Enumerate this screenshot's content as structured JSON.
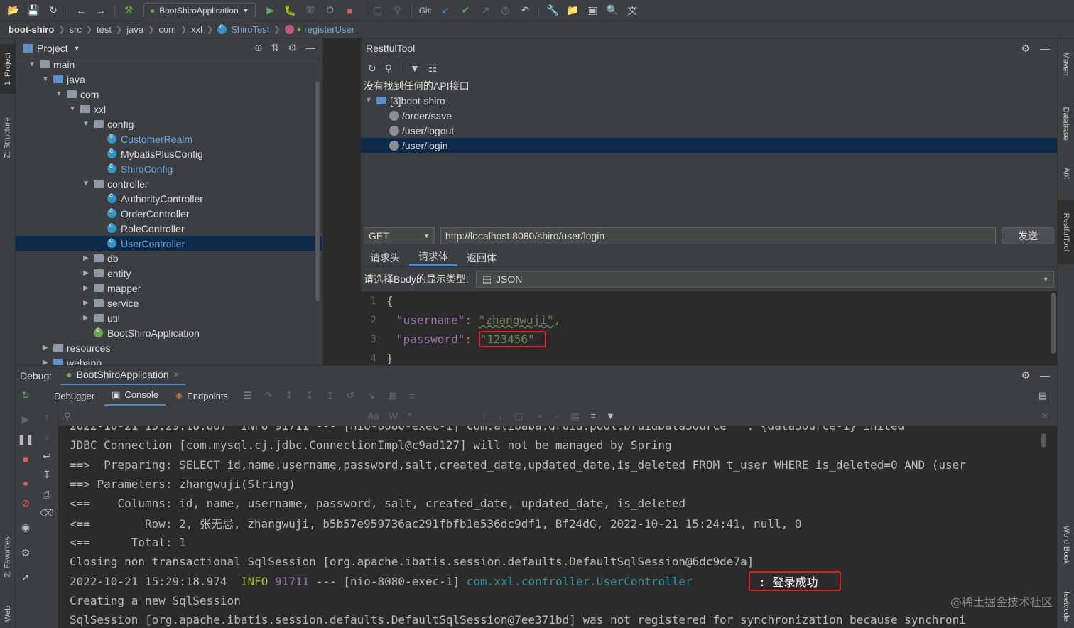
{
  "toolbar": {
    "run_config": "BootShiroApplication",
    "git_label": "Git:"
  },
  "breadcrumb": {
    "items": [
      "boot-shiro",
      "src",
      "test",
      "java",
      "com",
      "xxl",
      "ShiroTest",
      "registerUser"
    ]
  },
  "left_strip": {
    "project": "1: Project",
    "structure": "Z: Structure",
    "favorites": "2: Favorites",
    "web": "Web"
  },
  "right_strip": {
    "maven": "Maven",
    "database": "Database",
    "ant": "Ant",
    "restfultool": "RestfulTool",
    "wordbook": "Word Book",
    "leetcode": "leetcode"
  },
  "project_panel": {
    "title": "Project",
    "tree": [
      {
        "label": "main",
        "depth": 2,
        "type": "folder",
        "expanded": true
      },
      {
        "label": "java",
        "depth": 3,
        "type": "folder-blue",
        "expanded": true
      },
      {
        "label": "com",
        "depth": 4,
        "type": "folder",
        "expanded": true
      },
      {
        "label": "xxl",
        "depth": 5,
        "type": "folder",
        "expanded": true
      },
      {
        "label": "config",
        "depth": 6,
        "type": "folder",
        "expanded": true
      },
      {
        "label": "CustomerRealm",
        "depth": 7,
        "type": "class",
        "highlight": true
      },
      {
        "label": "MybatisPlusConfig",
        "depth": 7,
        "type": "class"
      },
      {
        "label": "ShiroConfig",
        "depth": 7,
        "type": "class",
        "highlight": true
      },
      {
        "label": "controller",
        "depth": 6,
        "type": "folder",
        "expanded": true
      },
      {
        "label": "AuthorityController",
        "depth": 7,
        "type": "class"
      },
      {
        "label": "OrderController",
        "depth": 7,
        "type": "class"
      },
      {
        "label": "RoleController",
        "depth": 7,
        "type": "class"
      },
      {
        "label": "UserController",
        "depth": 7,
        "type": "class",
        "highlight": true,
        "selected": true
      },
      {
        "label": "db",
        "depth": 6,
        "type": "folder",
        "expanded": false
      },
      {
        "label": "entity",
        "depth": 6,
        "type": "folder",
        "expanded": false
      },
      {
        "label": "mapper",
        "depth": 6,
        "type": "folder",
        "expanded": false
      },
      {
        "label": "service",
        "depth": 6,
        "type": "folder",
        "expanded": false
      },
      {
        "label": "util",
        "depth": 6,
        "type": "folder",
        "expanded": false
      },
      {
        "label": "BootShiroApplication",
        "depth": 6,
        "type": "boot"
      },
      {
        "label": "resources",
        "depth": 3,
        "type": "folder",
        "expanded": false
      },
      {
        "label": "webapp",
        "depth": 3,
        "type": "folder-blue",
        "expanded": false
      }
    ]
  },
  "restful": {
    "title": "RestfulTool",
    "no_api_msg": "没有找到任何的API接口",
    "module": "[3]boot-shiro",
    "apis": [
      {
        "path": "/order/save",
        "selected": false
      },
      {
        "path": "/user/logout",
        "selected": false
      },
      {
        "path": "/user/login",
        "selected": true
      }
    ],
    "method": "GET",
    "url": "http://localhost:8080/shiro/user/login",
    "send_label": "发送",
    "tabs": [
      "请求头",
      "请求体",
      "返回体"
    ],
    "active_tab": "请求体",
    "body_type_label": "请选择Body的显示类型:",
    "body_type_value": "JSON",
    "body_lines": [
      {
        "num": "1",
        "text": "{"
      },
      {
        "num": "2",
        "key": "\"username\"",
        "value": "\"zhangwuji\""
      },
      {
        "num": "3",
        "key": "\"password\"",
        "value": "\"123456\""
      },
      {
        "num": "4",
        "text": "}"
      }
    ]
  },
  "debug": {
    "label": "Debug:",
    "session": "BootShiroApplication",
    "subtabs": [
      "Debugger",
      "Console",
      "Endpoints"
    ],
    "active_subtab": "Console"
  },
  "console": {
    "lines": [
      "2022-10-21 15:29:18.887  INFO 91711 --- [nio-8080-exec-1] com.alibaba.druid.pool.DruidDataSource   : {dataSource-1} inited",
      "JDBC Connection [com.mysql.cj.jdbc.ConnectionImpl@c9ad127] will not be managed by Spring",
      "==>  Preparing: SELECT id,name,username,password,salt,created_date,updated_date,is_deleted FROM t_user WHERE is_deleted=0 AND (user",
      "==> Parameters: zhangwuji(String)",
      "<==    Columns: id, name, username, password, salt, created_date, updated_date, is_deleted",
      "<==        Row: 2, 张无忌, zhangwuji, b5b57e959736ac291fbfb1e536dc9df1, Bf24dG, 2022-10-21 15:24:41, null, 0",
      "<==      Total: 1",
      "Closing non transactional SqlSession [org.apache.ibatis.session.defaults.DefaultSqlSession@6dc9de7a]"
    ],
    "success_line": {
      "timestamp": "2022-10-21 15:29:18.974",
      "level": "INFO",
      "pid": "91711",
      "thread": "--- [nio-8080-exec-1]",
      "logger": "com.xxl.controller.UserController",
      "message": ": 登录成功"
    },
    "after_lines": [
      "Creating a new SqlSession",
      "SqlSession [org.apache.ibatis.session.defaults.DefaultSqlSession@7ee371bd] was not registered for synchronization because synchroni"
    ]
  },
  "watermark": "@稀土掘金技术社区"
}
